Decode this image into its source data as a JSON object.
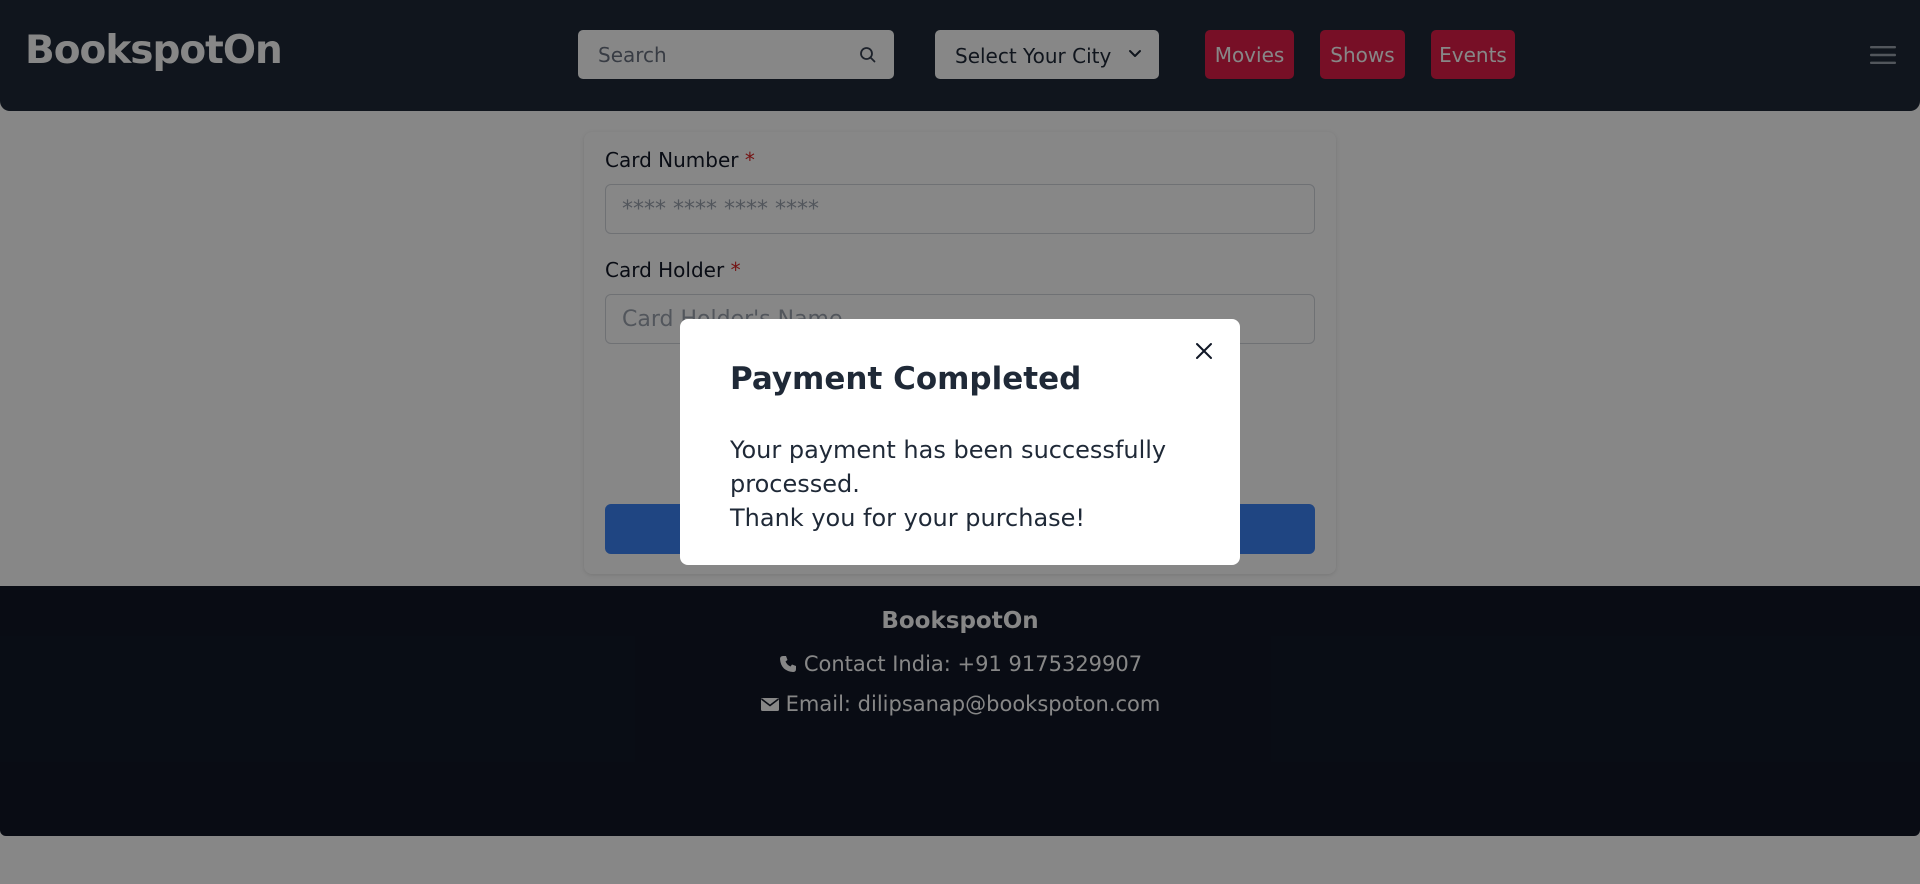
{
  "header": {
    "logo": "BookspotOn",
    "search_placeholder": "Search",
    "city_label": "Select Your City",
    "nav": [
      {
        "label": "Movies"
      },
      {
        "label": "Shows"
      },
      {
        "label": "Events"
      }
    ]
  },
  "form": {
    "card_number_label": "Card Number",
    "card_number_placeholder": "**** **** **** ****",
    "card_holder_label": "Card Holder",
    "card_holder_placeholder": "Card Holder's Name",
    "required_mark": "*"
  },
  "footer": {
    "brand": "BookspotOn",
    "contact": "Contact India: +91 9175329907",
    "email": "Email: dilipsanap@bookspoton.com"
  },
  "modal": {
    "title": "Payment Completed",
    "line1": "Your payment has been successfully processed.",
    "line2": "Thank you for your purchase!"
  },
  "colors": {
    "header_bg": "#1f2937",
    "nav_button": "#e11d48",
    "footer_bg": "#111827",
    "primary_button": "#3b82f6",
    "required": "#dc2626"
  }
}
